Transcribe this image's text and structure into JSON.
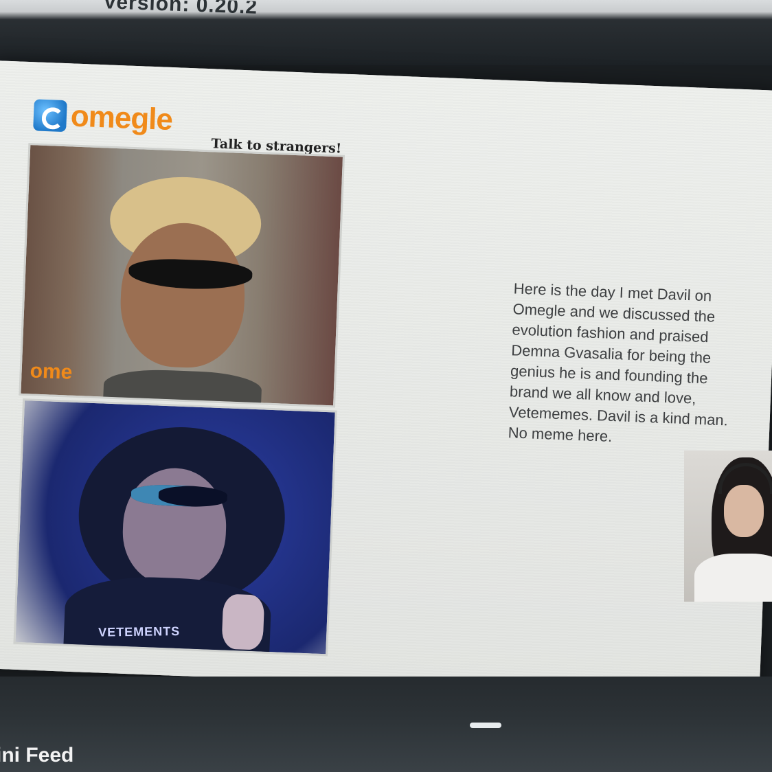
{
  "top_bar": {
    "version_text": "Version: 0.20.2"
  },
  "slide": {
    "logo_text": "omegle",
    "tagline": "Talk to strangers!",
    "stranger_watermark": "ome",
    "self_shirt_text": "VETEMENTS",
    "caption": "Here is the day I met Davil on Omegle and we discussed the evolution fashion and praised Demna Gvasalia for being the genius he is and founding the brand we all know and love, Vetememes. Davil is a kind man. No meme here."
  },
  "bottom_bar": {
    "feed_label": "ini Feed"
  },
  "colors": {
    "omegle_orange": "#f08a1a",
    "omegle_blue": "#1f79c9"
  }
}
